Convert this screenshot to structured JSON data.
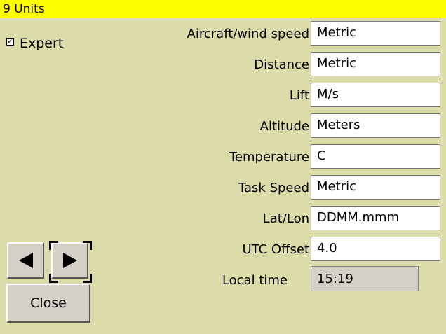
{
  "title": "9 Units",
  "expert": {
    "label": "Expert",
    "checked": true
  },
  "rows": [
    {
      "label": "Aircraft/wind speed",
      "value": "Metric"
    },
    {
      "label": "Distance",
      "value": "Metric"
    },
    {
      "label": "Lift",
      "value": "M/s"
    },
    {
      "label": "Altitude",
      "value": "Meters"
    },
    {
      "label": "Temperature",
      "value": "C"
    },
    {
      "label": "Task Speed",
      "value": "Metric"
    },
    {
      "label": "Lat/Lon",
      "value": "DDMM.mmm"
    },
    {
      "label": "UTC Offset",
      "value": "4.0"
    },
    {
      "label": "Local time",
      "value": "15:19"
    }
  ],
  "buttons": {
    "close": "Close",
    "prev_icon": "left-arrow-icon",
    "next_icon": "right-arrow-icon"
  },
  "colors": {
    "background": "#dcdcaa",
    "title_bar": "#ffff00",
    "field": "#ffffff",
    "readonly_field": "#d4d0c8"
  }
}
